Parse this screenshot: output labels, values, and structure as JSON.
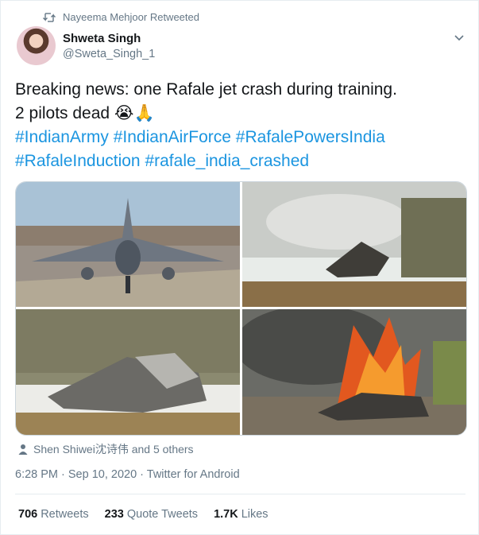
{
  "retweet_banner": {
    "text": "Nayeema Mehjoor Retweeted"
  },
  "author": {
    "name": "Shweta Singh",
    "handle": "@Sweta_Singh_1"
  },
  "tweet": {
    "line1": "Breaking news: one Rafale jet crash during training.",
    "line2": "2 pilots dead 😭🙏",
    "line3": "#IndianArmy #IndianAirForce #RafalePowersIndia",
    "line4": "#RafaleInduction #rafale_india_crashed"
  },
  "liked_by": "Shen Shiwei沈诗伟 and 5 others",
  "meta": "6:28 PM · Sep 10, 2020 · Twitter for Android",
  "stats": {
    "retweets_count": "706",
    "retweets_label": "Retweets",
    "quotes_count": "233",
    "quotes_label": "Quote Tweets",
    "likes_count": "1.7K",
    "likes_label": "Likes"
  },
  "colors": {
    "link": "#1b95e0",
    "secondary": "#657786"
  },
  "icons": {
    "retweet": "retweet-icon",
    "caret": "chevron-down-icon",
    "person": "person-icon"
  }
}
